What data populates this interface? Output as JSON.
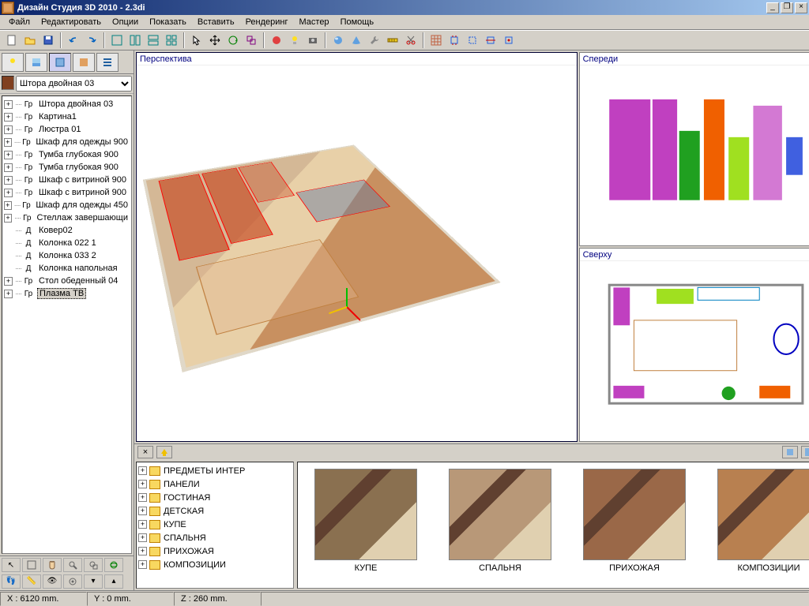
{
  "window": {
    "title": "Дизайн Студия 3D 2010 - 2.3di"
  },
  "menu": [
    "Файл",
    "Редактировать",
    "Опции",
    "Показать",
    "Вставить",
    "Рендеринг",
    "Мастер",
    "Помощь"
  ],
  "objectSelect": {
    "value": "Штора двойная 03"
  },
  "sceneTree": [
    {
      "tag": "Гр",
      "label": "Штора двойная 03",
      "exp": true
    },
    {
      "tag": "Гр",
      "label": "Картина1",
      "exp": true
    },
    {
      "tag": "Гр",
      "label": "Люстра 01",
      "exp": true
    },
    {
      "tag": "Гр",
      "label": "Шкаф для одежды 900",
      "exp": true
    },
    {
      "tag": "Гр",
      "label": "Тумба глубокая 900",
      "exp": true
    },
    {
      "tag": "Гр",
      "label": "Тумба глубокая 900",
      "exp": true
    },
    {
      "tag": "Гр",
      "label": "Шкаф с витриной 900",
      "exp": true
    },
    {
      "tag": "Гр",
      "label": "Шкаф с витриной 900",
      "exp": true
    },
    {
      "tag": "Гр",
      "label": "Шкаф для одежды 450",
      "exp": true
    },
    {
      "tag": "Гр",
      "label": "Стеллаж завершающи",
      "exp": true
    },
    {
      "tag": "Д",
      "label": "Ковер02",
      "exp": false
    },
    {
      "tag": "Д",
      "label": "Колонка 022 1",
      "exp": false
    },
    {
      "tag": "Д",
      "label": "Колонка 033 2",
      "exp": false
    },
    {
      "tag": "Д",
      "label": "Колонка напольная",
      "exp": false
    },
    {
      "tag": "Гр",
      "label": "Стол обеденный 04",
      "exp": true
    },
    {
      "tag": "Гр",
      "label": "Плазма ТВ",
      "exp": true,
      "sel": true
    }
  ],
  "viewports": {
    "perspective": "Перспектива",
    "front": "Спереди",
    "top": "Сверху"
  },
  "catalogTree": [
    "ПРЕДМЕТЫ ИНТЕР",
    "ПАНЕЛИ",
    "ГОСТИНАЯ",
    "ДЕТСКАЯ",
    "КУПЕ",
    "СПАЛЬНЯ",
    "ПРИХОЖАЯ",
    "КОМПОЗИЦИИ"
  ],
  "thumbs": [
    {
      "label": "КУПЕ",
      "color": "#8a7050"
    },
    {
      "label": "СПАЛЬНЯ",
      "color": "#b89878"
    },
    {
      "label": "ПРИХОЖАЯ",
      "color": "#9a6848"
    },
    {
      "label": "КОМПОЗИЦИИ",
      "color": "#b88050"
    }
  ],
  "status": {
    "x": "X : 6120 mm.",
    "y": "Y : 0 mm.",
    "z": "Z : 260 mm."
  }
}
